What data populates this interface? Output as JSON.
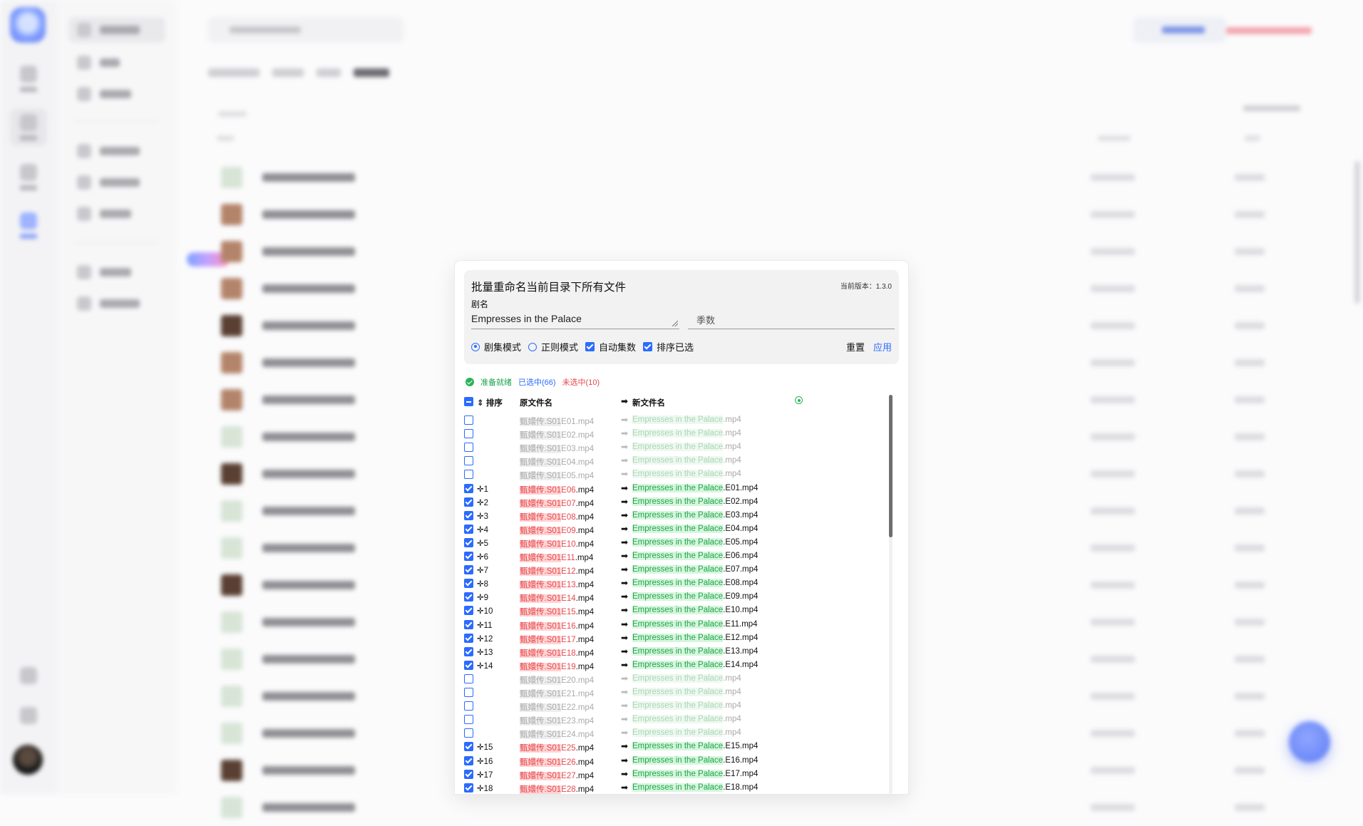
{
  "dialog": {
    "title": "批量重命名当前目录下所有文件",
    "version": "当前版本：1.3.0",
    "show_label": "剧名",
    "show_value": "Empresses in the Palace",
    "season_placeholder": "季数",
    "modes": [
      "剧集模式",
      "正则模式"
    ],
    "active_mode": "剧集模式",
    "checkboxes": [
      {
        "label": "自动集数",
        "checked": true
      },
      {
        "label": "排序已选",
        "checked": true
      }
    ],
    "reset_label": "重置",
    "apply_label": "应用",
    "status": {
      "ready": "准备就绪",
      "selected": "已选中(66)",
      "unselected": "未选中(10)"
    },
    "columns": {
      "order": "⇕ 排序",
      "original": "原文件名",
      "arrow": "➡",
      "new": "新文件名"
    },
    "rows": [
      {
        "checked": false,
        "idx": "",
        "o1": "甄嬛传.S01",
        "o2": "E01",
        "o3": ".mp4",
        "n1": "Empresses in the Palace",
        "n2": ".mp4"
      },
      {
        "checked": false,
        "idx": "",
        "o1": "甄嬛传.S01",
        "o2": "E02",
        "o3": ".mp4",
        "n1": "Empresses in the Palace",
        "n2": ".mp4"
      },
      {
        "checked": false,
        "idx": "",
        "o1": "甄嬛传.S01",
        "o2": "E03",
        "o3": ".mp4",
        "n1": "Empresses in the Palace",
        "n2": ".mp4"
      },
      {
        "checked": false,
        "idx": "",
        "o1": "甄嬛传.S01",
        "o2": "E04",
        "o3": ".mp4",
        "n1": "Empresses in the Palace",
        "n2": ".mp4"
      },
      {
        "checked": false,
        "idx": "",
        "o1": "甄嬛传.S01",
        "o2": "E05",
        "o3": ".mp4",
        "n1": "Empresses in the Palace",
        "n2": ".mp4"
      },
      {
        "checked": true,
        "idx": "1",
        "o1": "甄嬛传.S01",
        "o2": "E06",
        "o3": ".mp4",
        "n1": "Empresses in the Palace",
        "n2": ".E01.mp4"
      },
      {
        "checked": true,
        "idx": "2",
        "o1": "甄嬛传.S01",
        "o2": "E07",
        "o3": ".mp4",
        "n1": "Empresses in the Palace",
        "n2": ".E02.mp4"
      },
      {
        "checked": true,
        "idx": "3",
        "o1": "甄嬛传.S01",
        "o2": "E08",
        "o3": ".mp4",
        "n1": "Empresses in the Palace",
        "n2": ".E03.mp4"
      },
      {
        "checked": true,
        "idx": "4",
        "o1": "甄嬛传.S01",
        "o2": "E09",
        "o3": ".mp4",
        "n1": "Empresses in the Palace",
        "n2": ".E04.mp4"
      },
      {
        "checked": true,
        "idx": "5",
        "o1": "甄嬛传.S01",
        "o2": "E10",
        "o3": ".mp4",
        "n1": "Empresses in the Palace",
        "n2": ".E05.mp4"
      },
      {
        "checked": true,
        "idx": "6",
        "o1": "甄嬛传.S01",
        "o2": "E11",
        "o3": ".mp4",
        "n1": "Empresses in the Palace",
        "n2": ".E06.mp4"
      },
      {
        "checked": true,
        "idx": "7",
        "o1": "甄嬛传.S01",
        "o2": "E12",
        "o3": ".mp4",
        "n1": "Empresses in the Palace",
        "n2": ".E07.mp4"
      },
      {
        "checked": true,
        "idx": "8",
        "o1": "甄嬛传.S01",
        "o2": "E13",
        "o3": ".mp4",
        "n1": "Empresses in the Palace",
        "n2": ".E08.mp4"
      },
      {
        "checked": true,
        "idx": "9",
        "o1": "甄嬛传.S01",
        "o2": "E14",
        "o3": ".mp4",
        "n1": "Empresses in the Palace",
        "n2": ".E09.mp4"
      },
      {
        "checked": true,
        "idx": "10",
        "o1": "甄嬛传.S01",
        "o2": "E15",
        "o3": ".mp4",
        "n1": "Empresses in the Palace",
        "n2": ".E10.mp4"
      },
      {
        "checked": true,
        "idx": "11",
        "o1": "甄嬛传.S01",
        "o2": "E16",
        "o3": ".mp4",
        "n1": "Empresses in the Palace",
        "n2": ".E11.mp4"
      },
      {
        "checked": true,
        "idx": "12",
        "o1": "甄嬛传.S01",
        "o2": "E17",
        "o3": ".mp4",
        "n1": "Empresses in the Palace",
        "n2": ".E12.mp4"
      },
      {
        "checked": true,
        "idx": "13",
        "o1": "甄嬛传.S01",
        "o2": "E18",
        "o3": ".mp4",
        "n1": "Empresses in the Palace",
        "n2": ".E13.mp4"
      },
      {
        "checked": true,
        "idx": "14",
        "o1": "甄嬛传.S01",
        "o2": "E19",
        "o3": ".mp4",
        "n1": "Empresses in the Palace",
        "n2": ".E14.mp4"
      },
      {
        "checked": false,
        "idx": "",
        "o1": "甄嬛传.S01",
        "o2": "E20",
        "o3": ".mp4",
        "n1": "Empresses in the Palace",
        "n2": ".mp4"
      },
      {
        "checked": false,
        "idx": "",
        "o1": "甄嬛传.S01",
        "o2": "E21",
        "o3": ".mp4",
        "n1": "Empresses in the Palace",
        "n2": ".mp4"
      },
      {
        "checked": false,
        "idx": "",
        "o1": "甄嬛传.S01",
        "o2": "E22",
        "o3": ".mp4",
        "n1": "Empresses in the Palace",
        "n2": ".mp4"
      },
      {
        "checked": false,
        "idx": "",
        "o1": "甄嬛传.S01",
        "o2": "E23",
        "o3": ".mp4",
        "n1": "Empresses in the Palace",
        "n2": ".mp4"
      },
      {
        "checked": false,
        "idx": "",
        "o1": "甄嬛传.S01",
        "o2": "E24",
        "o3": ".mp4",
        "n1": "Empresses in the Palace",
        "n2": ".mp4"
      },
      {
        "checked": true,
        "idx": "15",
        "o1": "甄嬛传.S01",
        "o2": "E25",
        "o3": ".mp4",
        "n1": "Empresses in the Palace",
        "n2": ".E15.mp4"
      },
      {
        "checked": true,
        "idx": "16",
        "o1": "甄嬛传.S01",
        "o2": "E26",
        "o3": ".mp4",
        "n1": "Empresses in the Palace",
        "n2": ".E16.mp4"
      },
      {
        "checked": true,
        "idx": "17",
        "o1": "甄嬛传.S01",
        "o2": "E27",
        "o3": ".mp4",
        "n1": "Empresses in the Palace",
        "n2": ".E17.mp4"
      },
      {
        "checked": true,
        "idx": "18",
        "o1": "甄嬛传.S01",
        "o2": "E28",
        "o3": ".mp4",
        "n1": "Empresses in the Palace",
        "n2": ".E18.mp4"
      }
    ]
  },
  "background": {
    "rows": [
      "g",
      "b",
      "b",
      "b",
      "d",
      "b",
      "b",
      "g",
      "d",
      "g",
      "g",
      "d",
      "g",
      "g",
      "g",
      "g",
      "d",
      "g"
    ]
  },
  "colors": {
    "accent": "#2b6bff",
    "ok": "#17a34a",
    "error": "#e5484d"
  }
}
